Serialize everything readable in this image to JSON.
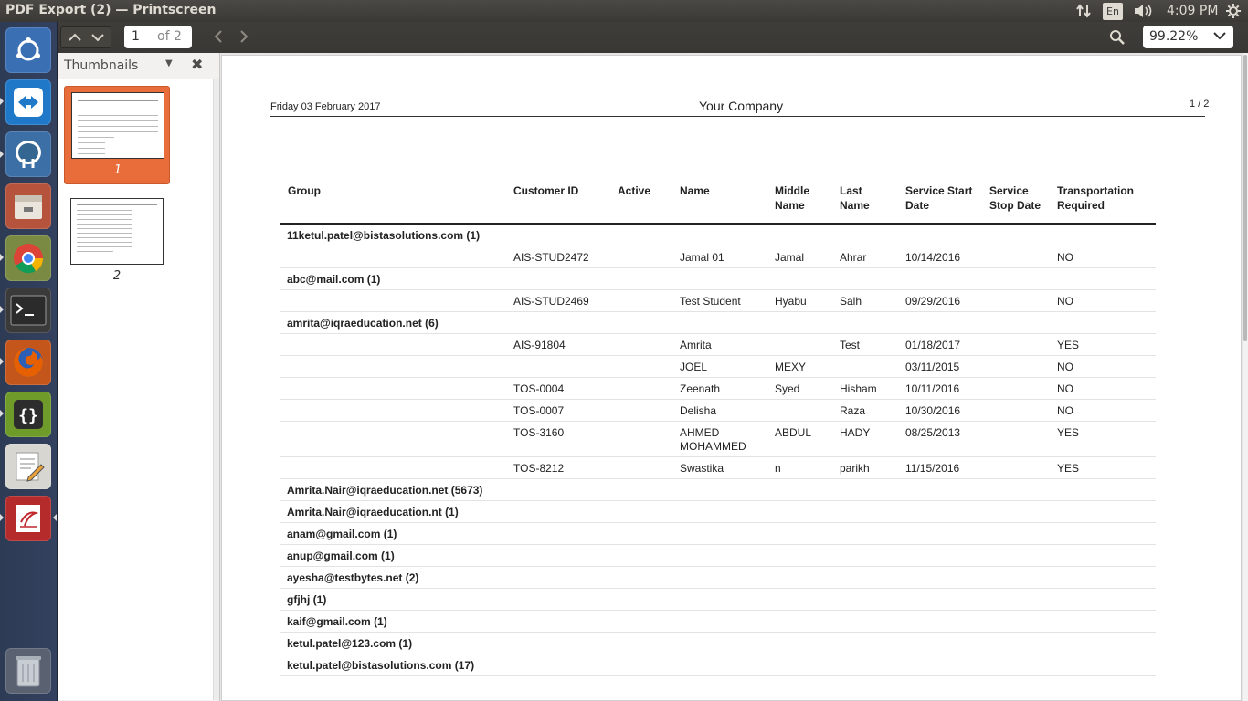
{
  "window": {
    "title": "PDF Export (2) — Printscreen"
  },
  "panel": {
    "keyboard_layout": "En",
    "clock": "4:09 PM"
  },
  "launcher": {
    "items": [
      {
        "name": "ubuntu-dash",
        "color": "#3b6fb4"
      },
      {
        "name": "teamviewer",
        "color": "#1f78c8"
      },
      {
        "name": "pgadmin-elephant",
        "color": "#3c6fa6"
      },
      {
        "name": "files",
        "color": "#b5533c"
      },
      {
        "name": "chrome",
        "color": "#7a8a42"
      },
      {
        "name": "terminal",
        "color": "#3a3a3a"
      },
      {
        "name": "firefox",
        "color": "#c4561b"
      },
      {
        "name": "brackets",
        "color": "#6f9b2a"
      },
      {
        "name": "text-editor",
        "color": "#d8d6d0"
      },
      {
        "name": "document-viewer",
        "color": "#b52a2a"
      },
      {
        "name": "trash",
        "color": "#5a6272"
      }
    ]
  },
  "toolbar": {
    "page_number": "1",
    "page_of": "of 2",
    "zoom": "99.22%"
  },
  "sidebar": {
    "title": "Thumbnails",
    "thumbs": [
      {
        "label": "1"
      },
      {
        "label": "2"
      }
    ]
  },
  "document": {
    "header_date": "Friday 03 February 2017",
    "header_company": "Your Company",
    "header_page": "1 / 2",
    "columns": {
      "group": "Group",
      "customer_id": "Customer ID",
      "active": "Active",
      "name": "Name",
      "middle_name": "Middle\nName",
      "last_name": "Last\nName",
      "service_start": "Service Start\nDate",
      "service_stop": "Service\nStop Date",
      "transport": "Transportation\nRequired"
    },
    "rows": [
      {
        "group": "11ketul.patel@bistasolutions.com (1)"
      },
      {
        "customer_id": "AIS-STUD2472",
        "name": "Jamal 01",
        "middle": "Jamal",
        "last": "Ahrar",
        "start": "10/14/2016",
        "transport": "NO"
      },
      {
        "group": "abc@mail.com (1)"
      },
      {
        "customer_id": "AIS-STUD2469",
        "name": "Test Student",
        "middle": "Hyabu",
        "last": "Salh",
        "start": "09/29/2016",
        "transport": "NO"
      },
      {
        "group": "amrita@iqraeducation.net (6)"
      },
      {
        "customer_id": "AIS-91804",
        "name": "Amrita",
        "middle": "",
        "last": "Test",
        "start": "01/18/2017",
        "transport": "YES"
      },
      {
        "customer_id": "",
        "name": "JOEL",
        "middle": "MEXY",
        "last": "",
        "start": "03/11/2015",
        "transport": "NO"
      },
      {
        "customer_id": "TOS-0004",
        "name": "Zeenath",
        "middle": "Syed",
        "last": "Hisham",
        "start": "10/11/2016",
        "transport": "NO"
      },
      {
        "customer_id": "TOS-0007",
        "name": "Delisha",
        "middle": "",
        "last": "Raza",
        "start": "10/30/2016",
        "transport": "NO"
      },
      {
        "customer_id": "TOS-3160",
        "name": "AHMED\nMOHAMMED",
        "middle": "ABDUL",
        "last": "HADY",
        "start": "08/25/2013",
        "transport": "YES"
      },
      {
        "customer_id": "TOS-8212",
        "name": "Swastika",
        "middle": "n",
        "last": "parikh",
        "start": "11/15/2016",
        "transport": "YES"
      },
      {
        "group": "Amrita.Nair@iqraeducation.net (5673)"
      },
      {
        "group": "Amrita.Nair@iqraeducation.nt (1)"
      },
      {
        "group": "anam@gmail.com (1)"
      },
      {
        "group": "anup@gmail.com (1)"
      },
      {
        "group": "ayesha@testbytes.net (2)"
      },
      {
        "group": "gfjhj (1)"
      },
      {
        "group": "kaif@gmail.com (1)"
      },
      {
        "group": "ketul.patel@123.com (1)"
      },
      {
        "group": "ketul.patel@bistasolutions.com (17)"
      }
    ]
  }
}
